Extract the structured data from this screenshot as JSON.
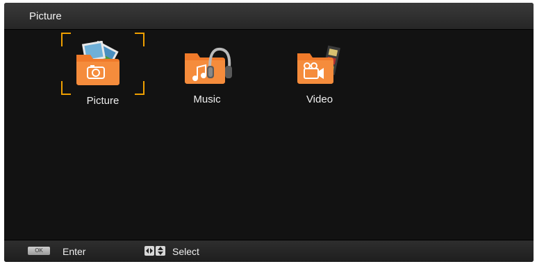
{
  "header": {
    "title": "Picture"
  },
  "menu": {
    "items": [
      {
        "label": "Picture",
        "icon": "picture-folder-icon",
        "selected": true
      },
      {
        "label": "Music",
        "icon": "music-folder-icon",
        "selected": false
      },
      {
        "label": "Video",
        "icon": "video-folder-icon",
        "selected": false
      }
    ]
  },
  "footer": {
    "ok_key": "OK",
    "ok_label": "Enter",
    "arrow_icons": "left-right-up-down-arrows-icon",
    "select_label": "Select"
  },
  "colors": {
    "accent": "#f0a000",
    "folder": "#f07a2a",
    "background": "#121212"
  }
}
